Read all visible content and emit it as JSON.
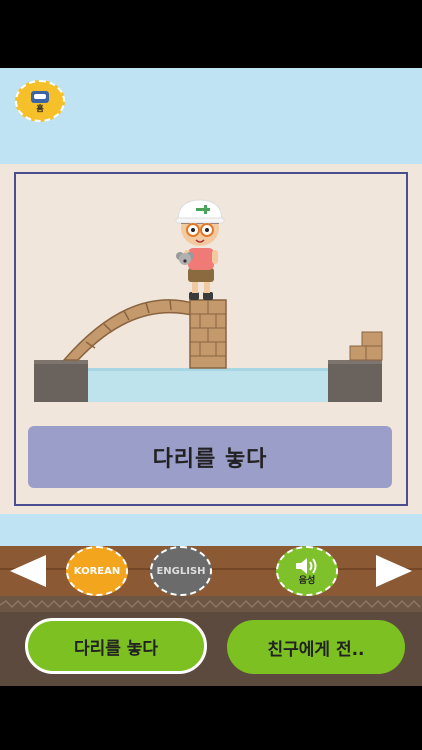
{
  "header": {
    "home_label": "홈"
  },
  "scene": {
    "caption": "다리를 놓다"
  },
  "controls": {
    "korean_label": "KOREAN",
    "english_label": "ENGLISH",
    "voice_label": "음성"
  },
  "footer": {
    "phrase_button": "다리를 놓다",
    "share_button": "친구에게 전.."
  },
  "colors": {
    "sky": "#bfe3f3",
    "accent_orange": "#f2a51d",
    "accent_green": "#7cc022",
    "caption_bg": "#9b9ec9",
    "frame_border": "#4a4d8e"
  }
}
